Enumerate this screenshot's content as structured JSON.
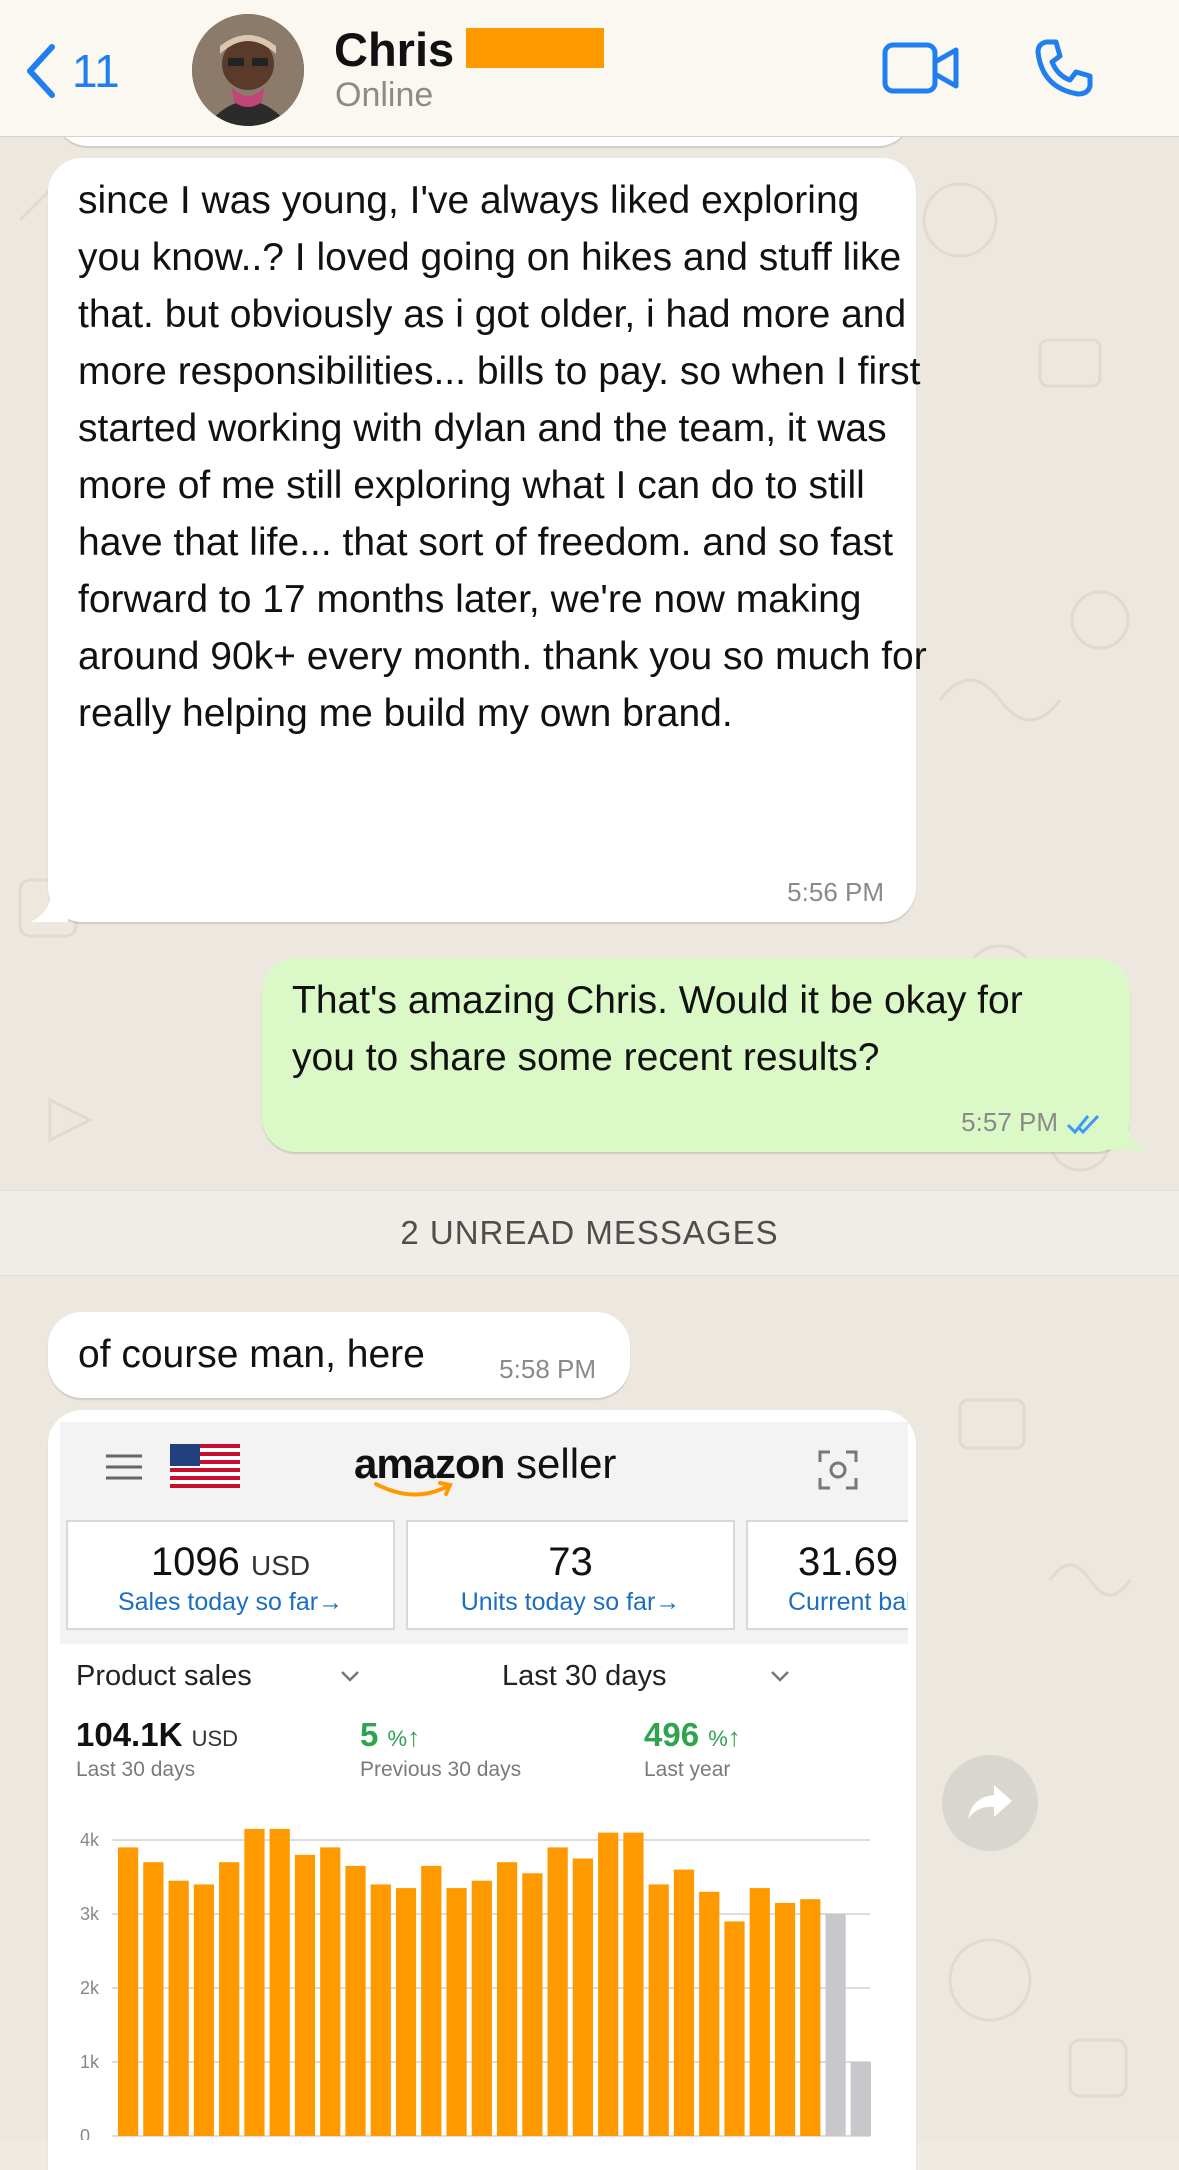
{
  "header": {
    "back_count": "11",
    "contact_name": "Chris",
    "status": "Online"
  },
  "messages": [
    {
      "direction": "incoming",
      "text": "since I was young, I've always liked exploring you know..? I loved going on hikes and stuff like that. but obviously as i got older, i had more and more responsibilities... bills to pay. so when I first started working with dylan and the team, it was more of me still exploring what I can do to still have that life... that sort of freedom. and so fast forward to 17 months later, we're now making around 90k+ every month. thank you so much for really helping me build my own brand.",
      "time": "5:56 PM"
    },
    {
      "direction": "outgoing",
      "text": "That's amazing Chris. Would it be okay for you to share some recent results?",
      "time": "5:57 PM",
      "read": true
    },
    {
      "direction": "incoming",
      "text": "of course man, here",
      "time": "5:58 PM"
    }
  ],
  "unread_banner": "2 UNREAD MESSAGES",
  "amazon": {
    "brand_word": "amazon",
    "brand_suffix": "seller",
    "kpis": [
      {
        "value": "1096",
        "unit": "USD",
        "link": "Sales today so far"
      },
      {
        "value": "73",
        "unit": "",
        "link": "Units today so far"
      },
      {
        "value": "31.69",
        "unit": "",
        "link": "Current balance"
      }
    ],
    "metric_select": "Product sales",
    "range_select": "Last 30 days",
    "total": {
      "value": "104.1K",
      "unit": "USD",
      "caption": "Last 30 days"
    },
    "prev": {
      "value": "5",
      "unit": "%",
      "caption": "Previous 30 days"
    },
    "last_year": {
      "value": "496",
      "unit": "%",
      "caption": "Last year"
    },
    "colors": {
      "bar": "#ff9900",
      "bar_partial": "#c7c7cc",
      "growth": "#2ea44f",
      "link": "#1b6ec2"
    }
  },
  "chart_data": {
    "type": "bar",
    "y_ticks": [
      "4k",
      "3k",
      "2k",
      "1k",
      "0"
    ],
    "ylim": [
      0,
      4000
    ],
    "values": [
      3900,
      3700,
      3450,
      3400,
      3700,
      4150,
      4150,
      3800,
      3900,
      3650,
      3400,
      3350,
      3650,
      3350,
      3450,
      3700,
      3550,
      3900,
      3750,
      4100,
      4100,
      3400,
      3600,
      3300,
      2900,
      3350,
      3150,
      3200,
      3000,
      1000
    ],
    "highlight_last": 2
  }
}
